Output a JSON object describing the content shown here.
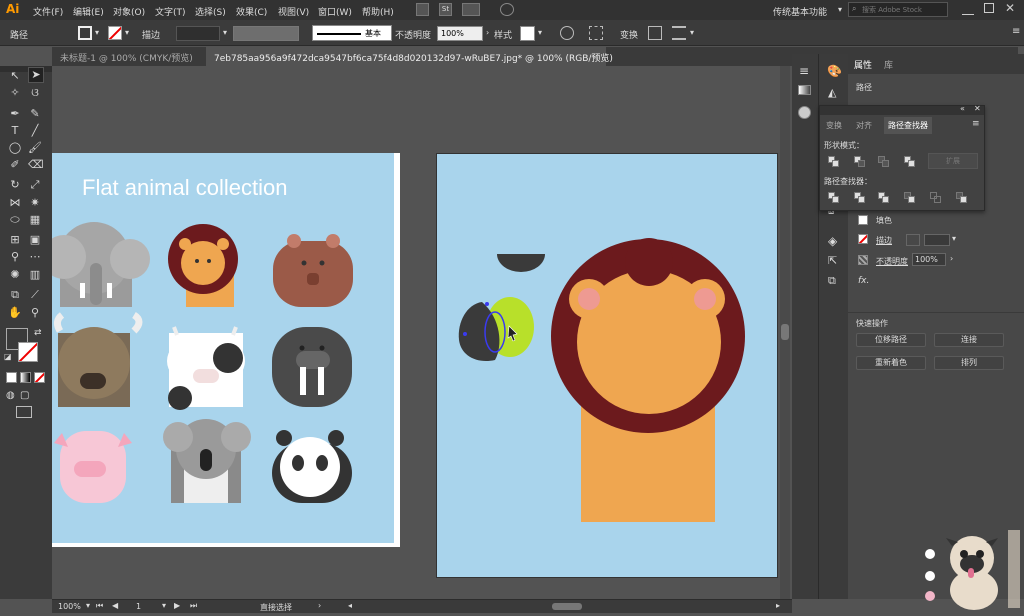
{
  "app": {
    "logo": "Ai"
  },
  "menu": [
    "文件(F)",
    "编辑(E)",
    "对象(O)",
    "文字(T)",
    "选择(S)",
    "效果(C)",
    "视图(V)",
    "窗口(W)",
    "帮助(H)"
  ],
  "workspace": {
    "name": "传统基本功能",
    "search_placeholder": "搜索 Adobe Stock"
  },
  "control": {
    "selection_label": "路径",
    "stroke_label": "描边",
    "brush_label": "基本",
    "opacity_label": "不透明度",
    "opacity_value": "100%",
    "style_label": "样式",
    "transform_label": "变换"
  },
  "tabs": [
    {
      "label": "未标题-1 @ 100% (CMYK/预览)"
    },
    {
      "label": "7eb785aa956a9f472dca9547bf6ca75f4d8d020132d97-wRuBE7.jpg* @ 100% (RGB/预览)"
    }
  ],
  "artboard": {
    "title": "Flat animal collection"
  },
  "status": {
    "zoom": "100%",
    "page": "1",
    "tool": "直接选择"
  },
  "panel": {
    "tabs": [
      "属性",
      "库"
    ],
    "selection": "路径",
    "fill_label": "填色",
    "stroke_label": "描边",
    "opacity_label": "不透明度",
    "opacity_value": "100%",
    "fx_label": "fx.",
    "quick_actions_title": "快速操作",
    "btn_offset_path": "位移路径",
    "btn_join": "连接",
    "btn_recolor": "重新着色",
    "btn_arrange": "排列"
  },
  "pathfinder": {
    "tabs": [
      "变换",
      "对齐",
      "路径查找器"
    ],
    "shape_modes_label": "形状模式：",
    "expand_label": "扩展",
    "pathfinders_label": "路径查找器："
  },
  "colors": {
    "artboard_bg": "#a9d4ec",
    "lion_mane": "#6c1a1d",
    "lion_face": "#efa650",
    "ear_inner": "#ee9a92",
    "dark": "#3a3a3a",
    "lime": "#b8e02a",
    "accent": "#ff9a00"
  }
}
